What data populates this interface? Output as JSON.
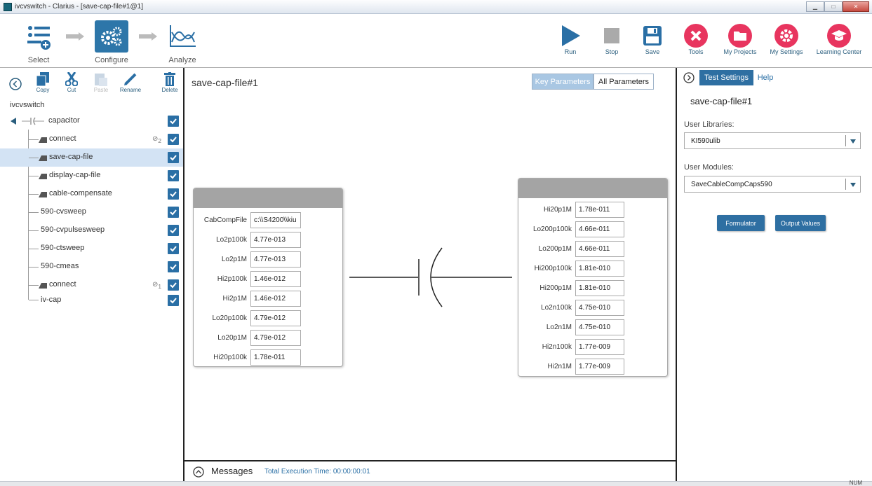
{
  "window": {
    "title": "ivcvswitch - Clarius - [save-cap-file#1@1]"
  },
  "workflow": {
    "select": "Select",
    "configure": "Configure",
    "analyze": "Analyze"
  },
  "toolbar": {
    "run": "Run",
    "stop": "Stop",
    "save": "Save",
    "tools": "Tools",
    "my_projects": "My Projects",
    "my_settings": "My Settings",
    "learning_center": "Learning Center"
  },
  "edit": {
    "copy": "Copy",
    "cut": "Cut",
    "paste": "Paste",
    "rename": "Rename",
    "delete": "Delete"
  },
  "tree": {
    "root": "ivcvswitch",
    "device": "capacitor",
    "items": [
      {
        "label": "connect",
        "link": "2"
      },
      {
        "label": "save-cap-file"
      },
      {
        "label": "display-cap-file"
      },
      {
        "label": "cable-compensate"
      },
      {
        "label": "590-cvsweep"
      },
      {
        "label": "590-cvpulsesweep"
      },
      {
        "label": "590-ctsweep"
      },
      {
        "label": "590-cmeas"
      },
      {
        "label": "connect",
        "link": "1"
      },
      {
        "label": "iv-cap"
      }
    ]
  },
  "center": {
    "title": "save-cap-file#1",
    "tab_key": "Key Parameters",
    "tab_all": "All Parameters",
    "left_params": [
      {
        "label": "CabCompFile",
        "value": "c:\\\\S4200\\\\kiu"
      },
      {
        "label": "Lo2p100k",
        "value": "4.77e-013"
      },
      {
        "label": "Lo2p1M",
        "value": "4.77e-013"
      },
      {
        "label": "Hi2p100k",
        "value": "1.46e-012"
      },
      {
        "label": "Hi2p1M",
        "value": "1.46e-012"
      },
      {
        "label": "Lo20p100k",
        "value": "4.79e-012"
      },
      {
        "label": "Lo20p1M",
        "value": "4.79e-012"
      },
      {
        "label": "Hi20p100k",
        "value": "1.78e-011"
      }
    ],
    "right_params": [
      {
        "label": "Hi20p1M",
        "value": "1.78e-011"
      },
      {
        "label": "Lo200p100k",
        "value": "4.66e-011"
      },
      {
        "label": "Lo200p1M",
        "value": "4.66e-011"
      },
      {
        "label": "Hi200p100k",
        "value": "1.81e-010"
      },
      {
        "label": "Hi200p1M",
        "value": "1.81e-010"
      },
      {
        "label": "Lo2n100k",
        "value": "4.75e-010"
      },
      {
        "label": "Lo2n1M",
        "value": "4.75e-010"
      },
      {
        "label": "Hi2n100k",
        "value": "1.77e-009"
      },
      {
        "label": "Hi2n1M",
        "value": "1.77e-009"
      }
    ]
  },
  "messages": {
    "label": "Messages",
    "exec_time": "Total Execution Time: 00:00:00:01"
  },
  "right": {
    "tab_settings": "Test Settings",
    "tab_help": "Help",
    "title": "save-cap-file#1",
    "user_libraries_label": "User Libraries:",
    "user_libraries_value": "KI590ulib",
    "user_modules_label": "User Modules:",
    "user_modules_value": "SaveCableCompCaps590",
    "formulator": "Formulator",
    "output_values": "Output Values"
  },
  "status": {
    "num": "NUM"
  },
  "colors": {
    "accent": "#2a6fa5",
    "brand_pink": "#e8355f",
    "header_gray": "#a4a4a4",
    "selected_row": "#d3e3f4"
  }
}
